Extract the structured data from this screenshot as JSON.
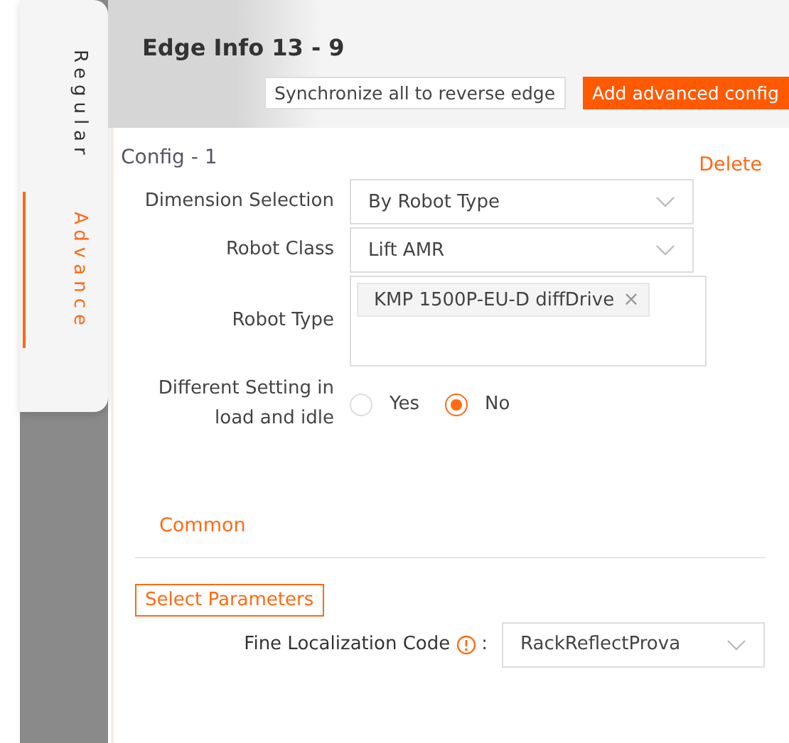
{
  "side_tabs": [
    {
      "label": "Regular",
      "selected": false
    },
    {
      "label": "Advance",
      "selected": true
    }
  ],
  "header": {
    "title": "Edge Info 13 - 9",
    "buttons": [
      {
        "label": "Synchronize all to reverse edge",
        "kind": "outline"
      },
      {
        "label": "Add advanced config",
        "kind": "primary"
      }
    ]
  },
  "config": {
    "title": "Config - 1",
    "delete": "Delete",
    "fields": [
      {
        "label": "Dimension Selection",
        "kind": "select",
        "value": "By Robot Type"
      },
      {
        "label": "Robot Class",
        "kind": "select",
        "value": "Lift AMR"
      },
      {
        "label": "Robot Type",
        "kind": "tags",
        "tags": [
          "KMP 1500P-EU-D diffDrive"
        ],
        "remove": "×"
      },
      {
        "label": "Different Setting in load and idle",
        "kind": "radio",
        "options": [
          {
            "label": "Yes",
            "selected": false
          },
          {
            "label": "No",
            "selected": true
          }
        ]
      }
    ],
    "section_tab": {
      "label": "Common",
      "selected": true
    },
    "select_parameters": "Select Parameters",
    "parameters": [
      {
        "label": "Fine Localization Code",
        "colon": ":",
        "value": "RackReflectProva"
      }
    ]
  }
}
